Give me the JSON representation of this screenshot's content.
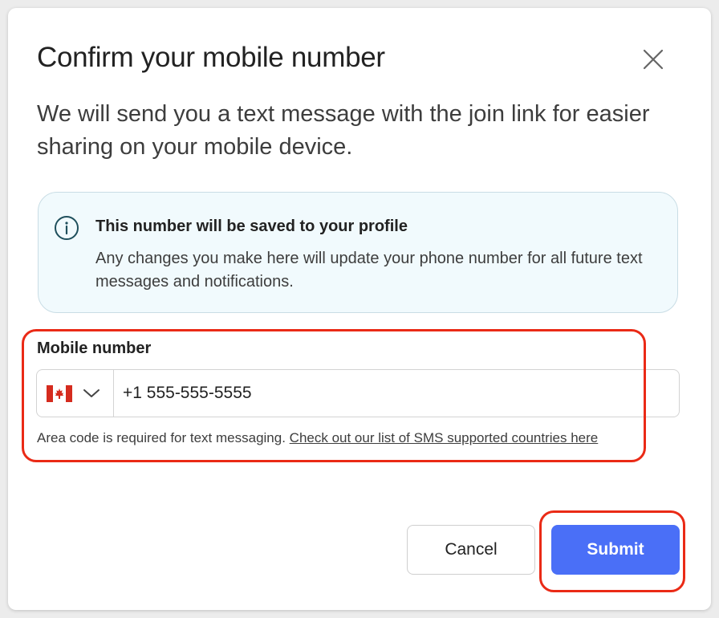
{
  "dialog": {
    "title": "Confirm your mobile number",
    "description": "We will send you a text message with the join link for easier sharing on your mobile device.",
    "close_icon": "close-icon"
  },
  "info_box": {
    "icon": "info-icon",
    "heading": "This number will be saved to your profile",
    "body": "Any changes you make here will update your phone number for all future text messages and notifications."
  },
  "mobile_field": {
    "label": "Mobile number",
    "country_flag": "canada-flag-icon",
    "country_dropdown_icon": "chevron-down-icon",
    "value": "+1 555-555-5555",
    "hint": "Area code is required for text messaging.",
    "hint_link": "Check out our list of SMS supported countries here"
  },
  "buttons": {
    "cancel": "Cancel",
    "submit": "Submit"
  },
  "colors": {
    "primary": "#4a6ff7",
    "info_bg": "#f1fafd",
    "annotation": "#ea2a16"
  }
}
